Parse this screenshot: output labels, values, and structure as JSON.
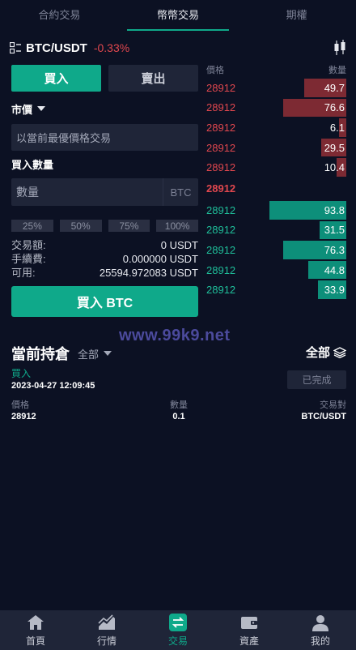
{
  "top_tabs": [
    {
      "label": "合約交易"
    },
    {
      "label": "幣幣交易"
    },
    {
      "label": "期權"
    }
  ],
  "pair": {
    "name": "BTC/USDT",
    "change": "-0.33%"
  },
  "trade": {
    "buy_label": "買入",
    "sell_label": "賣出",
    "market_label": "市價",
    "price_placeholder": "以當前最優價格交易",
    "qty_label": "買入數量",
    "qty_placeholder": "數量",
    "qty_unit": "BTC",
    "percents": [
      "25%",
      "50%",
      "75%",
      "100%"
    ],
    "amount_label": "交易額:",
    "amount_value": "0 USDT",
    "fee_label": "手續費:",
    "fee_value": "0.000000 USDT",
    "avail_label": "可用:",
    "avail_value": "25594.972083 USDT",
    "submit_label": "買入 BTC"
  },
  "orderbook": {
    "price_header": "價格",
    "qty_header": "數量",
    "asks": [
      {
        "price": "28912",
        "qty": "49.7",
        "depth": 0.3
      },
      {
        "price": "28912",
        "qty": "76.6",
        "depth": 0.45
      },
      {
        "price": "28912",
        "qty": "6.1",
        "depth": 0.05
      },
      {
        "price": "28912",
        "qty": "29.5",
        "depth": 0.18
      },
      {
        "price": "28912",
        "qty": "10.4",
        "depth": 0.07
      }
    ],
    "mid_price": "28912",
    "bids": [
      {
        "price": "28912",
        "qty": "93.8",
        "depth": 0.55
      },
      {
        "price": "28912",
        "qty": "31.5",
        "depth": 0.19
      },
      {
        "price": "28912",
        "qty": "76.3",
        "depth": 0.45
      },
      {
        "price": "28912",
        "qty": "44.8",
        "depth": 0.27
      },
      {
        "price": "28912",
        "qty": "33.9",
        "depth": 0.2
      }
    ]
  },
  "watermark": "www.99k9.net",
  "positions": {
    "title": "當前持倉",
    "filter": "全部",
    "all_label": "全部",
    "orders": [
      {
        "side": "買入",
        "time": "2023-04-27 12:09:45",
        "status": "已完成",
        "price_label": "價格",
        "price": "28912",
        "qty_label": "數量",
        "qty": "0.1",
        "pair_label": "交易對",
        "pair": "BTC/USDT"
      }
    ]
  },
  "nav": [
    {
      "label": "首頁",
      "icon": "home-icon"
    },
    {
      "label": "行情",
      "icon": "chart-icon"
    },
    {
      "label": "交易",
      "icon": "exchange-icon"
    },
    {
      "label": "資產",
      "icon": "wallet-icon"
    },
    {
      "label": "我的",
      "icon": "user-icon"
    }
  ],
  "colors": {
    "accent": "#0fa98a",
    "ask": "#e0474e",
    "bid": "#1fbf9a",
    "background": "#0c1123",
    "panel": "#1f2538"
  }
}
